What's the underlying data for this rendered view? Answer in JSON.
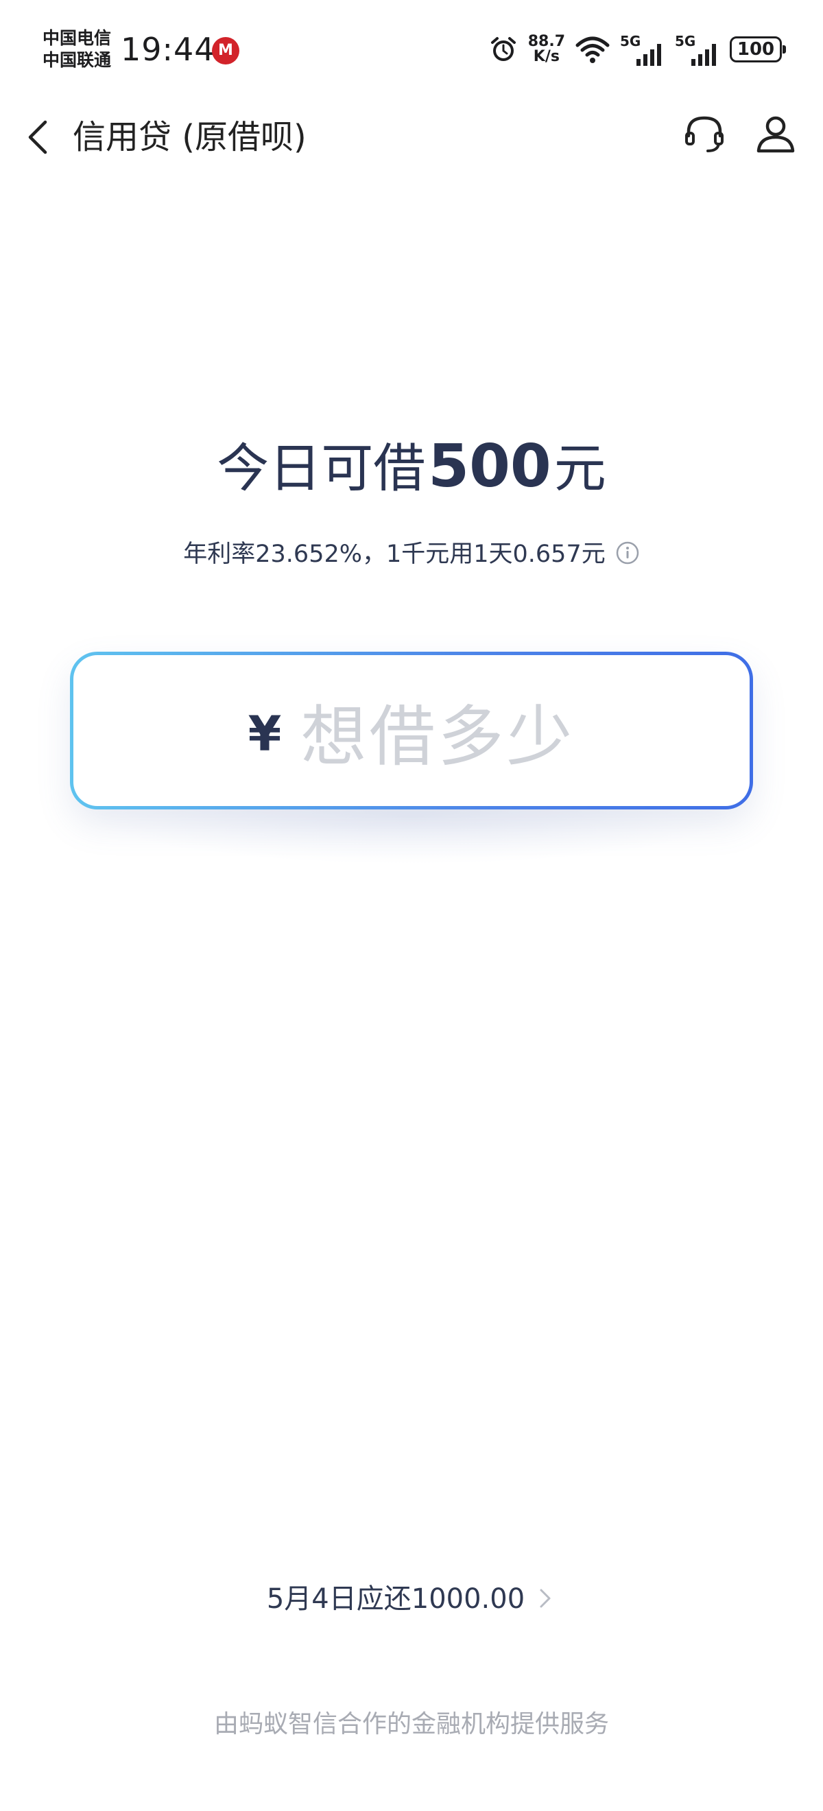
{
  "status_bar": {
    "carrier_1": "中国电信",
    "carrier_2": "中国联通",
    "time": "19:44",
    "net_speed_value": "88.7",
    "net_speed_unit": "K/s",
    "sim1_network": "5G",
    "sim2_network": "5G",
    "battery": "100"
  },
  "nav": {
    "title": "信用贷 (原借呗)"
  },
  "headline": {
    "prefix": "今日可借",
    "amount": "500",
    "suffix": "元"
  },
  "rate_text": "年利率23.652%，1千元用1天0.657元",
  "input": {
    "currency_symbol": "¥",
    "placeholder": "想借多少"
  },
  "repay_text": "5月4日应还1000.00",
  "footer_note": "由蚂蚁智信合作的金融机构提供服务",
  "colors": {
    "primary_text": "#2a3452",
    "placeholder": "#cfd2d8",
    "border_start": "#5fc3ef",
    "border_end": "#3f6ee6",
    "footer": "#a8abb3"
  }
}
